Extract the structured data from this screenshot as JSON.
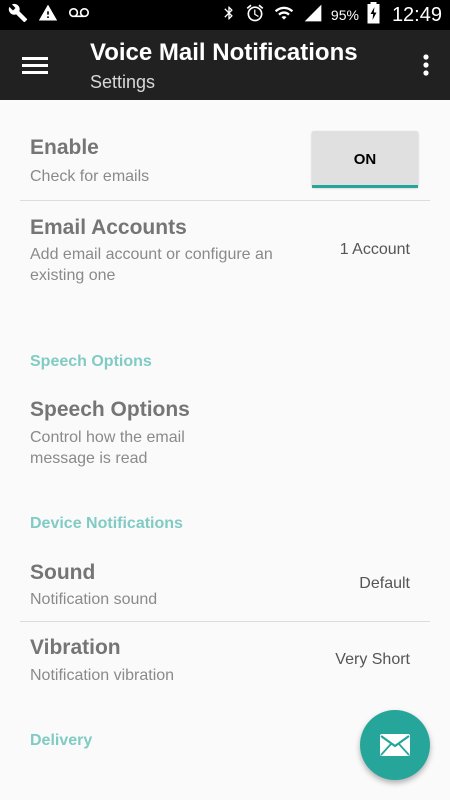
{
  "status_bar": {
    "battery_percent": "95%",
    "time": "12:49",
    "icons_left": [
      "wrench-icon",
      "warning-icon",
      "voicemail-icon"
    ],
    "icons_right": [
      "bluetooth-icon",
      "alarm-icon",
      "wifi-icon",
      "signal-icon",
      "battery-charging-icon"
    ]
  },
  "toolbar": {
    "title": "Voice Mail Notifications",
    "subtitle": "Settings"
  },
  "prefs": {
    "enable": {
      "title": "Enable",
      "summary": "Check for emails",
      "toggle_label": "ON",
      "checked": true
    },
    "email_accounts": {
      "title": "Email Accounts",
      "summary": "Add email account or configure an existing one",
      "value": "1 Account"
    },
    "speech_category": "Speech Options",
    "speech_options": {
      "title": "Speech Options",
      "summary": "Control how the email message is read"
    },
    "device_category": "Device Notifications",
    "sound": {
      "title": "Sound",
      "summary": "Notification sound",
      "value": "Default"
    },
    "vibration": {
      "title": "Vibration",
      "summary": "Notification vibration",
      "value": "Very Short"
    },
    "delivery_category": "Delivery"
  },
  "fab": {
    "icon": "email-icon"
  },
  "colors": {
    "accent": "#26a69a",
    "category": "#80cbc4",
    "toolbar": "#212121",
    "status_bar": "#000000"
  }
}
